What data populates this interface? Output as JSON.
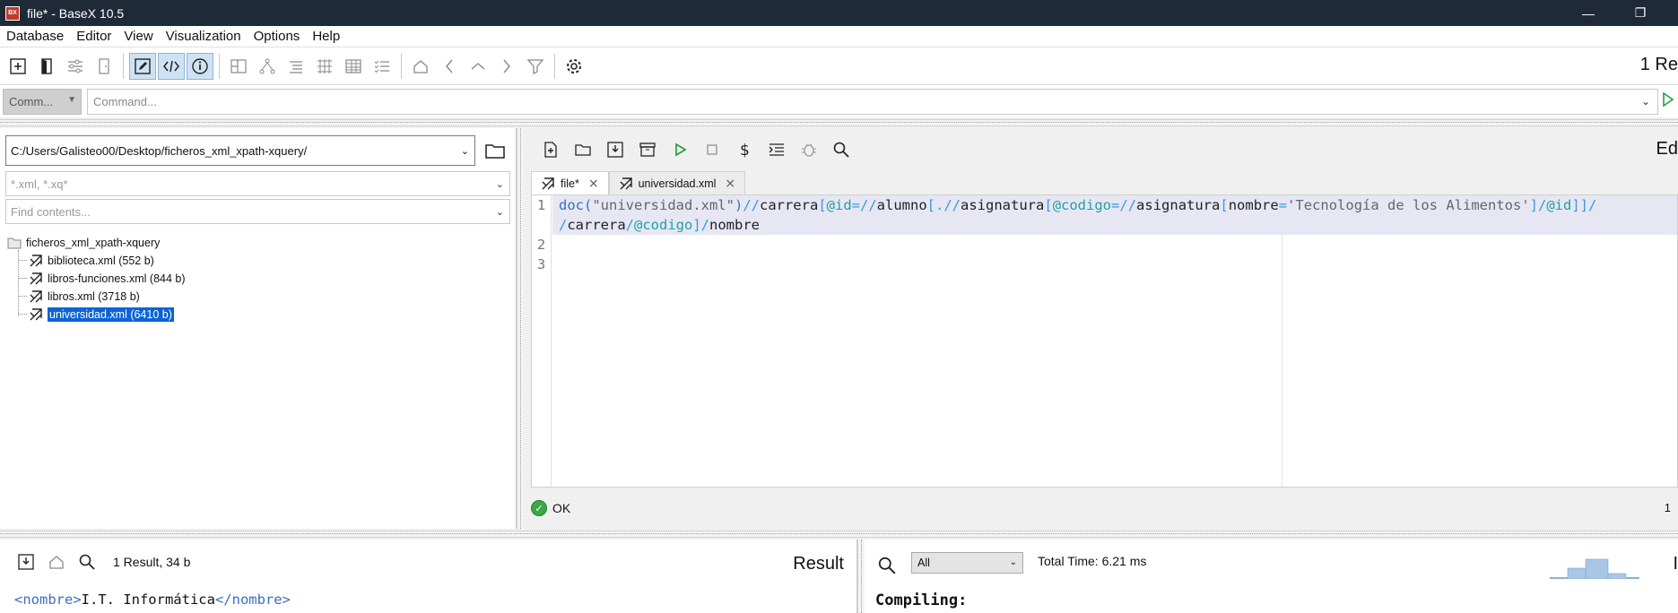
{
  "window": {
    "title": "file* - BaseX 10.5",
    "minimize": "—",
    "maximize": "❐"
  },
  "menu": [
    "Database",
    "Editor",
    "View",
    "Visualization",
    "Options",
    "Help"
  ],
  "toolbar": {
    "result_count_partial": "1 Re"
  },
  "command": {
    "mode": "Comm...",
    "placeholder": "Command..."
  },
  "project": {
    "path": "C:/Users/Galisteo00/Desktop/ficheros_xml_xpath-xquery/",
    "filter_placeholder": "*.xml, *.xq*",
    "contents_placeholder": "Find contents...",
    "root": "ficheros_xml_xpath-xquery",
    "files": [
      "biblioteca.xml (552 b)",
      "libros-funciones.xml (844 b)",
      "libros.xml (3718 b)",
      "universidad.xml (6410 b)"
    ],
    "selected_index": 3
  },
  "editor": {
    "label_partial": "Ed",
    "tabs": [
      {
        "label": "file*",
        "active": true
      },
      {
        "label": "universidad.xml",
        "active": false
      }
    ],
    "line_numbers": [
      "1",
      "",
      "2",
      "3"
    ],
    "code": {
      "doc": "doc(",
      "docarg": "\"universidad.xml\"",
      "close": ")",
      "sl2": "//",
      "carrera": "carrera",
      "lb": "[",
      "at_id": "@id",
      "eq": "=",
      "sl2b": "//",
      "alumno": "alumno",
      "lb2": "[",
      "dot": ".//",
      "asig": "asignatura",
      "lb3": "[",
      "at_cod": "@codigo",
      "eq2": "=",
      "sl2c": "//",
      "asig2": "asignatura",
      "lb4": "[",
      "nombre": "nombre",
      "eq3": "=",
      "lit": "'Tecnología de los Alimentos'",
      "rb": "]/",
      "at_id2": "@id",
      "rb2": "]]/",
      "l2_sl": "/",
      "l2_carrera": "carrera",
      "l2_sl2": "/",
      "l2_at": "@codigo",
      "l2_rb": "]/",
      "l2_nombre": "nombre"
    },
    "status": "OK",
    "column": "1"
  },
  "result": {
    "count": "1 Result, 34 b",
    "label": "Result",
    "open_tag": "<nombre>",
    "value": "I.T. Informática",
    "close_tag": "</nombre>"
  },
  "info": {
    "filter": "All",
    "total_time": "Total Time: 6.21 ms",
    "compiling": "Compiling:",
    "label_partial": "I"
  },
  "colors": {
    "titlebar": "#1e2a38",
    "selection": "#0a64d6",
    "ok": "#3aa845",
    "xml_tag": "#3a6fc4"
  }
}
